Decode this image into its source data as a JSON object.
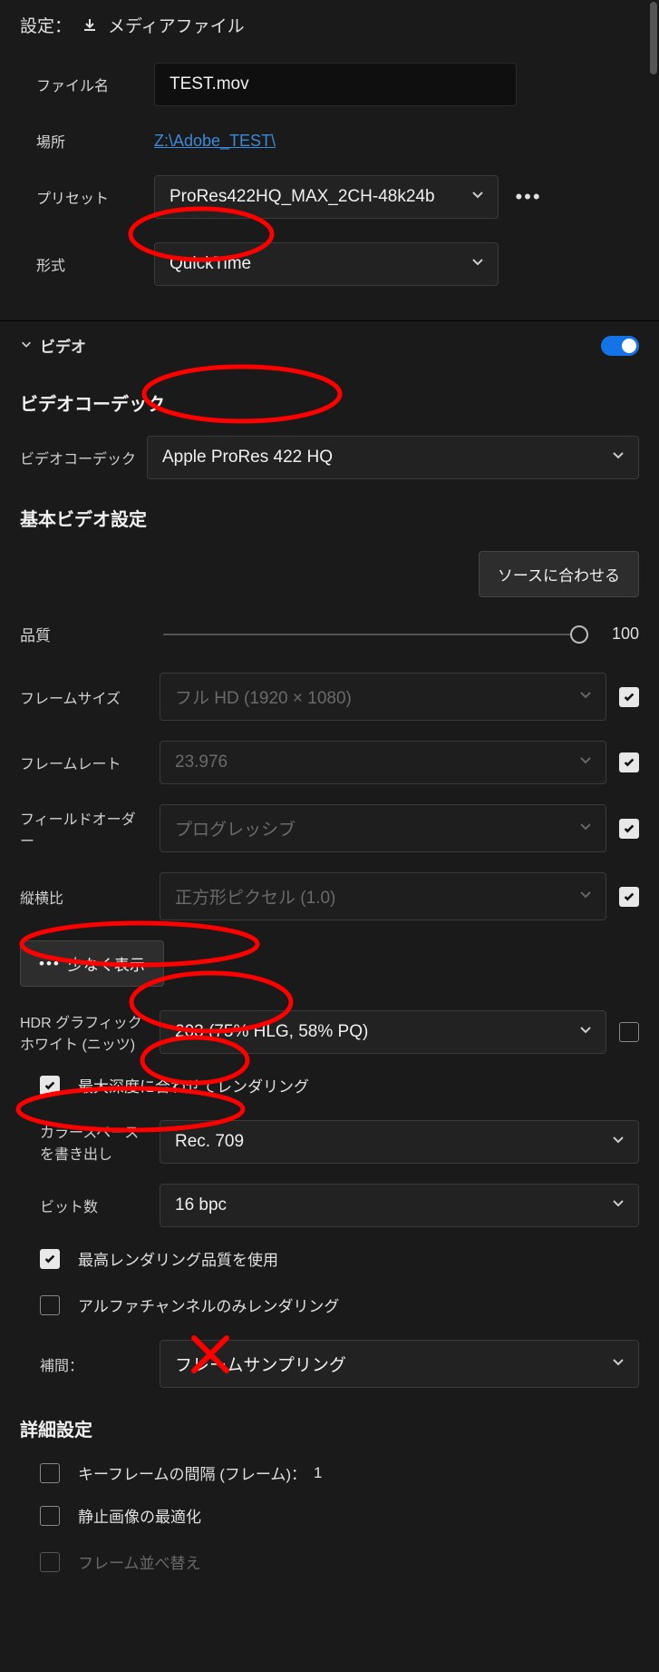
{
  "header": {
    "title": "設定：",
    "media_file": "メディアファイル"
  },
  "file": {
    "name_label": "ファイル名",
    "name_value": "TEST.mov",
    "location_label": "場所",
    "location_value": "Z:\\Adobe_TEST\\",
    "preset_label": "プリセット",
    "preset_value": "ProRes422HQ_MAX_2CH-48k24b",
    "format_label": "形式",
    "format_value": "QuickTime"
  },
  "video_section": {
    "title": "ビデオ",
    "codec_heading": "ビデオコーデック",
    "codec_label": "ビデオコーデック",
    "codec_value": "Apple ProRes 422 HQ",
    "basic_heading": "基本ビデオ設定",
    "match_source_btn": "ソースに合わせる",
    "quality_label": "品質",
    "quality_value": "100",
    "frame_size_label": "フレームサイズ",
    "frame_size_value": "フル HD (1920 × 1080)",
    "frame_rate_label": "フレームレート",
    "frame_rate_value": "23.976",
    "field_order_label": "フィールドオーダー",
    "field_order_value": "プログレッシブ",
    "aspect_label": "縦横比",
    "aspect_value": "正方形ピクセル (1.0)",
    "less_btn": "少なく表示",
    "hdr_label": "HDR グラフィックホワイト (ニッツ)",
    "hdr_value": "203 (75% HLG, 58% PQ)",
    "max_depth_label": "最大深度に合わせてレンダリング",
    "colorspace_label": "カラースペースを書き出し",
    "colorspace_value": "Rec. 709",
    "bitdepth_label": "ビット数",
    "bitdepth_value": "16 bpc",
    "max_quality_label": "最高レンダリング品質を使用",
    "alpha_only_label": "アルファチャンネルのみレンダリング",
    "interp_label": "補間：",
    "interp_value": "フレームサンプリング"
  },
  "advanced": {
    "heading": "詳細設定",
    "keyframe_label": "キーフレームの間隔 (フレーム)：",
    "keyframe_value": "1",
    "still_opt_label": "静止画像の最適化",
    "frame_reorder_label": "フレーム並べ替え"
  }
}
